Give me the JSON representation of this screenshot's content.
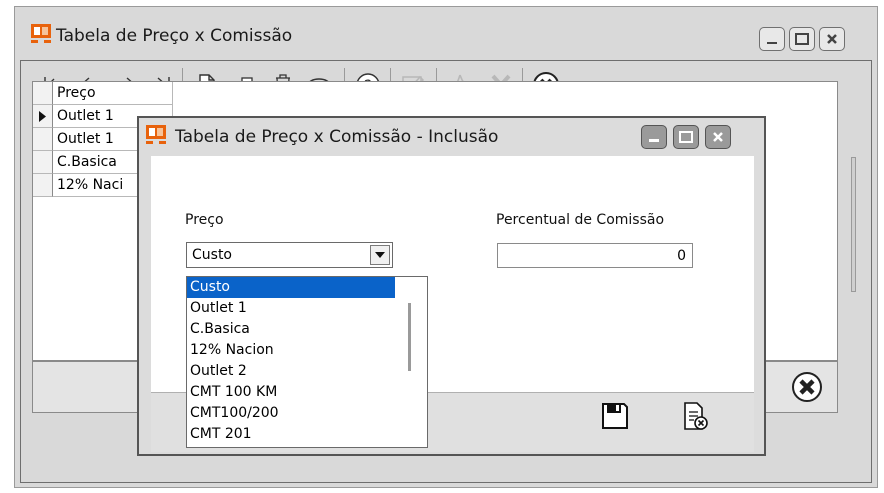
{
  "main_window": {
    "title": "Tabela de Preço x Comissão"
  },
  "toolbar": {
    "buttons": [
      "first-icon",
      "prev-icon",
      "next-icon",
      "last-icon",
      "new-icon",
      "print-icon",
      "delete-icon",
      "view-icon",
      "help-icon",
      "edit-icon",
      "pdf-icon",
      "excel-icon",
      "close-icon"
    ]
  },
  "grid": {
    "header": "Preço",
    "rows": [
      "Outlet 1",
      "Outlet 1",
      "C.Basica",
      "12% Naci"
    ]
  },
  "dialog": {
    "title": "Tabela de Preço x Comissão - Inclusão",
    "preco_label": "Preço",
    "preco_value": "Custo",
    "percentual_label": "Percentual de Comissão",
    "percentual_value": "0",
    "dropdown_options": [
      "Custo",
      "Outlet 1",
      "C.Basica",
      "12% Nacion",
      "Outlet 2",
      "CMT 100 KM",
      "CMT100/200",
      "CMT 201"
    ],
    "selected_option_index": 0
  },
  "colors": {
    "selection": "#0a63c9",
    "app_icon_orange": "#e8620c"
  }
}
